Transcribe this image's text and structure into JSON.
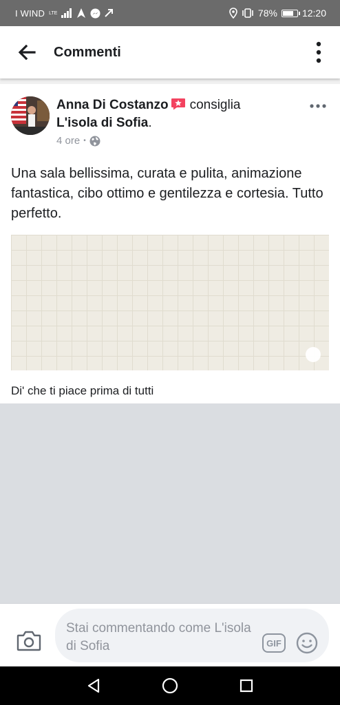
{
  "status_bar": {
    "carrier": "I WIND",
    "network": "LTE",
    "battery_percent": "78%",
    "battery_level": 0.78,
    "time": "12:20"
  },
  "app_bar": {
    "title": "Commenti"
  },
  "post": {
    "author": "Anna Di Costanzo",
    "recommends": "consiglia",
    "page": "L'isola di Sofia",
    "page_suffix": ".",
    "time_ago": "4 ore",
    "separator": "•",
    "privacy": "globe-icon",
    "text": "Una sala bellissima, curata e pulita, animazione fantastica, cibo ottimo e gentilezza e cortesia. Tutto perfetto.",
    "like_prompt": "Di' che ti piace prima di tutti"
  },
  "composer": {
    "placeholder": "Stai commentando come L'isola di Sofia",
    "gif_label": "GIF"
  },
  "colors": {
    "badge": "#f3425f",
    "muted": "#90949c",
    "empty_area": "#dadde1"
  }
}
